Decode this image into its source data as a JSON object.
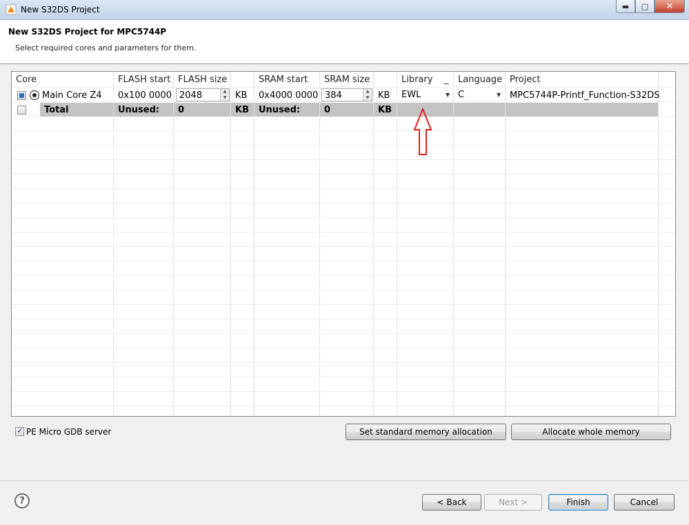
{
  "window": {
    "title": "New S32DS Project"
  },
  "header": {
    "title": "New S32DS Project for MPC5744P",
    "description": "Select required cores and parameters for them."
  },
  "table": {
    "columns": [
      "Core",
      "FLASH start",
      "FLASH size",
      "",
      "SRAM start",
      "SRAM size",
      "",
      "Library",
      "_",
      "Language",
      "Project"
    ],
    "row_main": {
      "core": "Main Core Z4",
      "flash_start": "0x100 0000",
      "flash_size": "2048",
      "flash_unit": "KB",
      "sram_start": "0x4000 0000",
      "sram_size": "384",
      "sram_unit": "KB",
      "library": "EWL",
      "language": "C",
      "project": "MPC5744P-Printf_Function-S32DS"
    },
    "row_total": {
      "core": "Total",
      "flash_start": "Unused:",
      "flash_size": "0",
      "flash_unit": "KB",
      "sram_start": "Unused:",
      "sram_size": "0",
      "sram_unit": "KB"
    }
  },
  "options": {
    "gdb_label": "PE Micro GDB server",
    "gdb_checked": true
  },
  "buttons": {
    "standard_alloc": "Set standard memory allocation",
    "whole_alloc": "Allocate whole memory",
    "back": "< Back",
    "next": "Next >",
    "finish": "Finish",
    "cancel": "Cancel"
  },
  "colors": {
    "annotation_arrow": "#e02020",
    "selection_blue": "#2a6fc4"
  }
}
